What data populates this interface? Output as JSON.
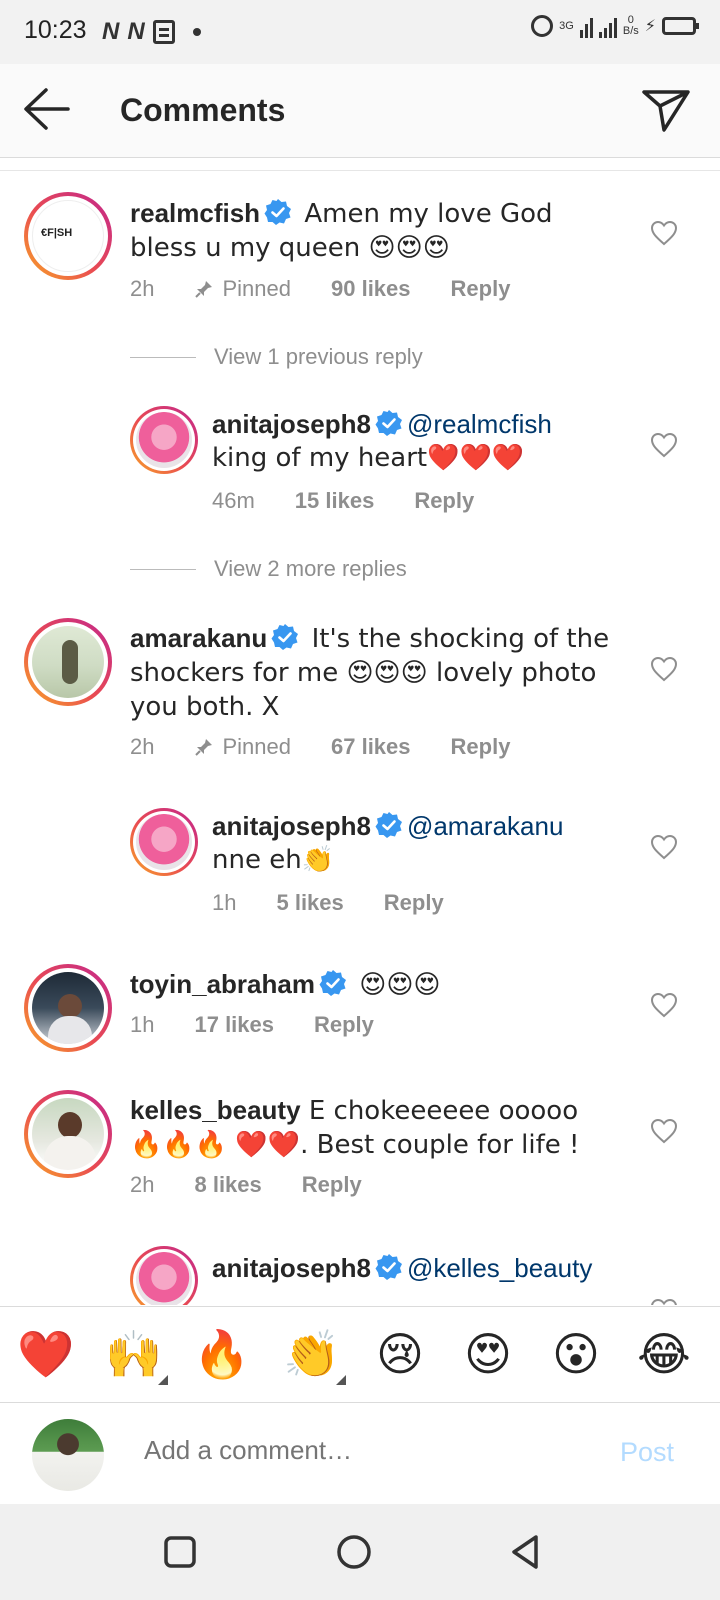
{
  "status_bar": {
    "time": "10:23",
    "net_speed_value": "0",
    "net_speed_unit": "B/s",
    "signal_label": "3G"
  },
  "header": {
    "title": "Comments"
  },
  "comments": [
    {
      "username": "realmcfish",
      "text": " Amen my love God bless u my queen 😍😍😍",
      "time": "2h",
      "pinned": "Pinned",
      "likes": "90 likes",
      "reply": "Reply",
      "avatar_text": "€F|SH"
    },
    {
      "username": "anitajoseph8",
      "mention": "@realmcfish",
      "text": "king of my heart❤️❤️❤️",
      "time": "46m",
      "likes": "15 likes",
      "reply": "Reply"
    },
    {
      "username": "amarakanu",
      "text": " It's the shocking of the shockers for me 😍😍😍 lovely photo you both. X",
      "time": "2h",
      "pinned": "Pinned",
      "likes": "67 likes",
      "reply": "Reply"
    },
    {
      "username": "anitajoseph8",
      "mention": "@amarakanu",
      "text": "nne eh👏",
      "time": "1h",
      "likes": "5 likes",
      "reply": "Reply"
    },
    {
      "username": "toyin_abraham",
      "text": " 😍😍😍",
      "time": "1h",
      "likes": "17 likes",
      "reply": "Reply"
    },
    {
      "username": "kelles_beauty",
      "text": " E chokeeeeee ooooo 🔥🔥🔥 ❤️❤️. Best couple for life !",
      "time": "2h",
      "likes": "8 likes",
      "reply": "Reply"
    },
    {
      "username": "anitajoseph8",
      "mention": "@kelles_beauty"
    }
  ],
  "view_previous": "View 1 previous reply",
  "view_more": "View 2 more replies",
  "reactions": [
    "❤️",
    "🙌",
    "🔥",
    "👏",
    "😢",
    "😍",
    "😮",
    "😂"
  ],
  "compose": {
    "placeholder": "Add a comment…",
    "post_label": "Post"
  },
  "colors": {
    "mention": "#00376b",
    "meta": "#8e8e8e",
    "verified": "#3897f0",
    "post": "#b3dbff"
  }
}
